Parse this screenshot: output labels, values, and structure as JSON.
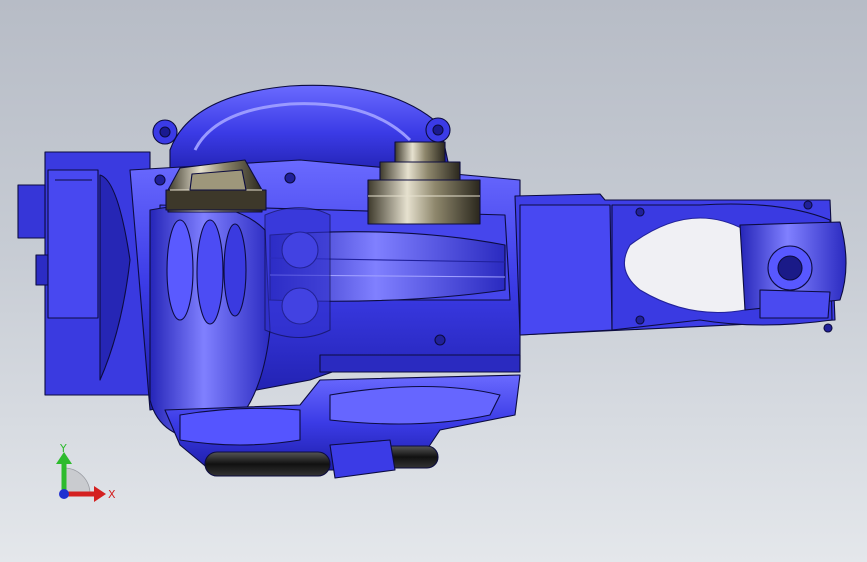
{
  "viewport": {
    "background_top": "#b7bcc6",
    "background_bottom": "#e4e7eb"
  },
  "model": {
    "body_color": "#3f3fe8",
    "body_dark": "#1c1ca6",
    "body_light": "#7a7aff",
    "gear_color": "#6a6450",
    "edge_color": "#0c0c40"
  },
  "triad": {
    "y_label": "Y",
    "x_label": "X",
    "y_color": "#2dbb2d",
    "x_color": "#d42020",
    "z_color": "#2030d0",
    "icon": "axis-triad-icon"
  }
}
